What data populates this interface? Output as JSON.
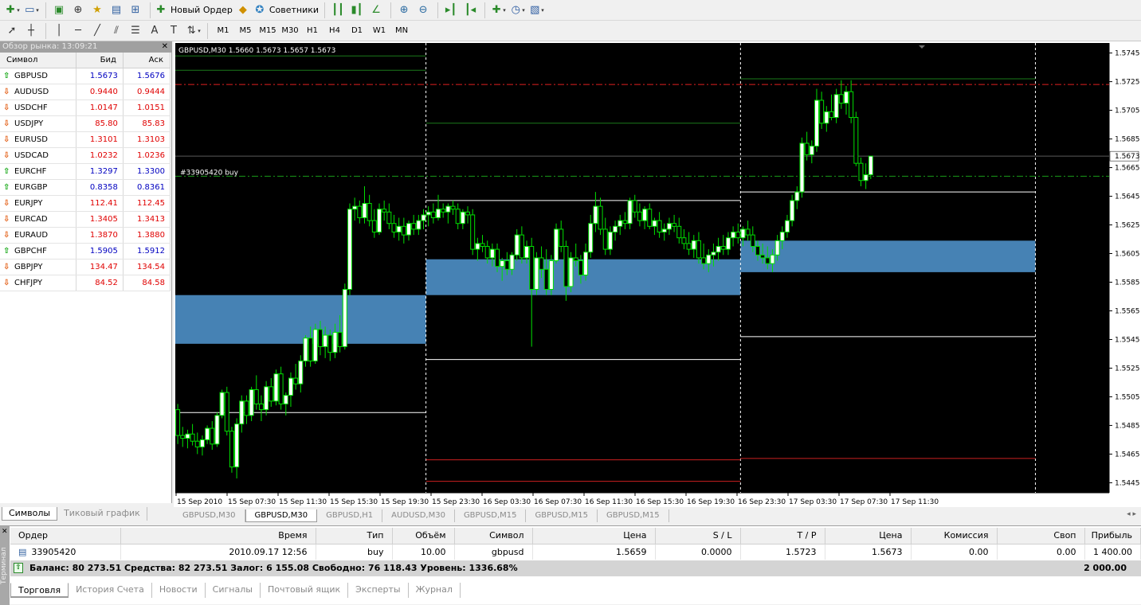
{
  "toolbar": {
    "new_order": "Новый Ордер",
    "advisors": "Советники",
    "timeframes": [
      "M1",
      "M5",
      "M15",
      "M30",
      "H1",
      "H4",
      "D1",
      "W1",
      "MN"
    ]
  },
  "market_watch": {
    "title": "Обзор рынка: 13:09:21",
    "columns": [
      "Символ",
      "Бид",
      "Аск"
    ],
    "rows": [
      {
        "symbol": "GBPUSD",
        "bid": "1.5673",
        "ask": "1.5676",
        "dir": "up"
      },
      {
        "symbol": "AUDUSD",
        "bid": "0.9440",
        "ask": "0.9444",
        "dir": "down"
      },
      {
        "symbol": "USDCHF",
        "bid": "1.0147",
        "ask": "1.0151",
        "dir": "down"
      },
      {
        "symbol": "USDJPY",
        "bid": "85.80",
        "ask": "85.83",
        "dir": "down"
      },
      {
        "symbol": "EURUSD",
        "bid": "1.3101",
        "ask": "1.3103",
        "dir": "down"
      },
      {
        "symbol": "USDCAD",
        "bid": "1.0232",
        "ask": "1.0236",
        "dir": "down"
      },
      {
        "symbol": "EURCHF",
        "bid": "1.3297",
        "ask": "1.3300",
        "dir": "up"
      },
      {
        "symbol": "EURGBP",
        "bid": "0.8358",
        "ask": "0.8361",
        "dir": "up"
      },
      {
        "symbol": "EURJPY",
        "bid": "112.41",
        "ask": "112.45",
        "dir": "down"
      },
      {
        "symbol": "EURCAD",
        "bid": "1.3405",
        "ask": "1.3413",
        "dir": "down"
      },
      {
        "symbol": "EURAUD",
        "bid": "1.3870",
        "ask": "1.3880",
        "dir": "down"
      },
      {
        "symbol": "GBPCHF",
        "bid": "1.5905",
        "ask": "1.5912",
        "dir": "up"
      },
      {
        "symbol": "GBPJPY",
        "bid": "134.47",
        "ask": "134.54",
        "dir": "down"
      },
      {
        "symbol": "CHFJPY",
        "bid": "84.52",
        "ask": "84.58",
        "dir": "down"
      }
    ],
    "tabs": [
      "Символы",
      "Тиковый график"
    ]
  },
  "chart": {
    "header": "GBPUSD,M30  1.5660 1.5673 1.5657 1.5673",
    "order_label": "#33905420 buy",
    "current_price": "1.5673",
    "price_ticks": [
      "1.5745",
      "1.5725",
      "1.5705",
      "1.5685",
      "1.5665",
      "1.5645",
      "1.5625",
      "1.5605",
      "1.5585",
      "1.5565",
      "1.5545",
      "1.5525",
      "1.5505",
      "1.5485",
      "1.5465",
      "1.5445"
    ],
    "time_ticks": [
      "15 Sep 2010",
      "15 Sep 07:30",
      "15 Sep 11:30",
      "15 Sep 15:30",
      "15 Sep 19:30",
      "15 Sep 23:30",
      "16 Sep 03:30",
      "16 Sep 07:30",
      "16 Sep 11:30",
      "16 Sep 15:30",
      "16 Sep 19:30",
      "16 Sep 23:30",
      "17 Sep 03:30",
      "17 Sep 07:30",
      "17 Sep 11:30"
    ],
    "tabs": [
      "GBPUSD,M30",
      "GBPUSD,M30",
      "GBPUSD,H1",
      "AUDUSD,M30",
      "GBPUSD,M15",
      "GBPUSD,M15",
      "GBPUSD,M15"
    ],
    "active_tab": 1
  },
  "chart_data": {
    "type": "candlestick",
    "symbol": "GBPUSD",
    "timeframe": "M30",
    "ylim": [
      1.5438,
      1.5752
    ],
    "last_price": 1.5673,
    "order_price": 1.5659,
    "take_profit": 1.5723,
    "zones": [
      {
        "from_bar": 0,
        "to_bar": 51,
        "low": 1.5542,
        "high": 1.5576,
        "color": "#4682b4"
      },
      {
        "from_bar": 51,
        "to_bar": 115,
        "low": 1.5576,
        "high": 1.5601,
        "color": "#4682b4"
      },
      {
        "from_bar": 115,
        "to_bar": 175,
        "low": 1.5592,
        "high": 1.5614,
        "color": "#4682b4"
      }
    ],
    "hlines": [
      {
        "from_bar": 0,
        "to_bar": 51,
        "price": 1.5494,
        "color": "#ffffff"
      },
      {
        "from_bar": 51,
        "to_bar": 115,
        "price": 1.5531,
        "color": "#ffffff"
      },
      {
        "from_bar": 51,
        "to_bar": 115,
        "price": 1.5642,
        "color": "#ffffff"
      },
      {
        "from_bar": 115,
        "to_bar": 175,
        "price": 1.5547,
        "color": "#ffffff"
      },
      {
        "from_bar": 115,
        "to_bar": 175,
        "price": 1.5648,
        "color": "#ffffff"
      },
      {
        "from_bar": 0,
        "to_bar": 51,
        "price": 1.5733,
        "color": "#1a7a1a"
      },
      {
        "from_bar": 0,
        "to_bar": 51,
        "price": 1.5743,
        "color": "#1a7a1a"
      },
      {
        "from_bar": 51,
        "to_bar": 115,
        "price": 1.5696,
        "color": "#1a7a1a"
      },
      {
        "from_bar": 115,
        "to_bar": 175,
        "price": 1.5727,
        "color": "#1a7a1a"
      },
      {
        "from_bar": 51,
        "to_bar": 115,
        "price": 1.5446,
        "color": "#cc2020"
      },
      {
        "from_bar": 51,
        "to_bar": 115,
        "price": 1.5461,
        "color": "#cc2020"
      },
      {
        "from_bar": 115,
        "to_bar": 175,
        "price": 1.5462,
        "color": "#cc2020"
      }
    ],
    "vlines_bars": [
      51,
      115,
      175
    ],
    "candles": [
      [
        1.5496,
        1.55,
        1.5472,
        1.5478
      ],
      [
        1.5478,
        1.5484,
        1.547,
        1.5476
      ],
      [
        1.5476,
        1.5482,
        1.5469,
        1.5479
      ],
      [
        1.5479,
        1.5486,
        1.5471,
        1.5474
      ],
      [
        1.5474,
        1.548,
        1.5465,
        1.547
      ],
      [
        1.547,
        1.5478,
        1.5464,
        1.5475
      ],
      [
        1.5475,
        1.5485,
        1.5472,
        1.5483
      ],
      [
        1.5483,
        1.5488,
        1.5468,
        1.5472
      ],
      [
        1.5472,
        1.5494,
        1.547,
        1.5492
      ],
      [
        1.5492,
        1.551,
        1.549,
        1.5508
      ],
      [
        1.5508,
        1.5512,
        1.5478,
        1.5481
      ],
      [
        1.5481,
        1.5484,
        1.5452,
        1.5456
      ],
      [
        1.5456,
        1.549,
        1.5448,
        1.5486
      ],
      [
        1.5486,
        1.5506,
        1.548,
        1.5502
      ],
      [
        1.5502,
        1.5506,
        1.5486,
        1.5492
      ],
      [
        1.5492,
        1.5512,
        1.5488,
        1.551
      ],
      [
        1.551,
        1.552,
        1.5496,
        1.55
      ],
      [
        1.55,
        1.5506,
        1.5488,
        1.5496
      ],
      [
        1.5496,
        1.5516,
        1.5492,
        1.5512
      ],
      [
        1.5512,
        1.5518,
        1.5498,
        1.5502
      ],
      [
        1.5502,
        1.5524,
        1.5499,
        1.5521
      ],
      [
        1.5521,
        1.5526,
        1.5496,
        1.55
      ],
      [
        1.55,
        1.5508,
        1.5492,
        1.5506
      ],
      [
        1.5506,
        1.5522,
        1.5498,
        1.5518
      ],
      [
        1.5518,
        1.5528,
        1.551,
        1.5514
      ],
      [
        1.5514,
        1.5534,
        1.5508,
        1.553
      ],
      [
        1.553,
        1.5548,
        1.5526,
        1.5546
      ],
      [
        1.5546,
        1.5554,
        1.5526,
        1.553
      ],
      [
        1.553,
        1.5556,
        1.5528,
        1.5552
      ],
      [
        1.5552,
        1.5558,
        1.5534,
        1.554
      ],
      [
        1.554,
        1.5554,
        1.5532,
        1.5548
      ],
      [
        1.5548,
        1.5552,
        1.553,
        1.5536
      ],
      [
        1.5536,
        1.5556,
        1.5532,
        1.555
      ],
      [
        1.555,
        1.5562,
        1.5536,
        1.554
      ],
      [
        1.554,
        1.5584,
        1.5538,
        1.558
      ],
      [
        1.558,
        1.564,
        1.5576,
        1.5636
      ],
      [
        1.5636,
        1.5644,
        1.5628,
        1.5638
      ],
      [
        1.5638,
        1.5642,
        1.5626,
        1.563
      ],
      [
        1.563,
        1.5652,
        1.5626,
        1.564
      ],
      [
        1.564,
        1.5646,
        1.5624,
        1.5628
      ],
      [
        1.5628,
        1.5636,
        1.5616,
        1.562
      ],
      [
        1.562,
        1.564,
        1.5618,
        1.5636
      ],
      [
        1.5636,
        1.5642,
        1.5628,
        1.5634
      ],
      [
        1.5634,
        1.564,
        1.5622,
        1.5626
      ],
      [
        1.5626,
        1.5632,
        1.5616,
        1.562
      ],
      [
        1.562,
        1.563,
        1.5614,
        1.5624
      ],
      [
        1.5624,
        1.563,
        1.5612,
        1.5618
      ],
      [
        1.5618,
        1.5628,
        1.5614,
        1.5626
      ],
      [
        1.5626,
        1.5632,
        1.5618,
        1.5622
      ],
      [
        1.5622,
        1.5632,
        1.5618,
        1.5628
      ],
      [
        1.5628,
        1.5636,
        1.5622,
        1.5632
      ],
      [
        1.5632,
        1.5638,
        1.5624,
        1.5634
      ],
      [
        1.5634,
        1.564,
        1.5626,
        1.563
      ],
      [
        1.563,
        1.5646,
        1.5628,
        1.5636
      ],
      [
        1.5636,
        1.564,
        1.563,
        1.5634
      ],
      [
        1.5634,
        1.564,
        1.5626,
        1.5638
      ],
      [
        1.5638,
        1.5642,
        1.5632,
        1.5636
      ],
      [
        1.5636,
        1.564,
        1.5622,
        1.5626
      ],
      [
        1.5626,
        1.5636,
        1.5622,
        1.5634
      ],
      [
        1.5634,
        1.5638,
        1.5626,
        1.5632
      ],
      [
        1.5632,
        1.5636,
        1.5604,
        1.5608
      ],
      [
        1.5608,
        1.5616,
        1.56,
        1.5612
      ],
      [
        1.5612,
        1.5618,
        1.5606,
        1.561
      ],
      [
        1.561,
        1.5614,
        1.5598,
        1.5602
      ],
      [
        1.5602,
        1.5612,
        1.5596,
        1.5608
      ],
      [
        1.5608,
        1.5612,
        1.5592,
        1.5596
      ],
      [
        1.5596,
        1.5602,
        1.5586,
        1.56
      ],
      [
        1.56,
        1.5606,
        1.559,
        1.5594
      ],
      [
        1.5594,
        1.5606,
        1.559,
        1.5604
      ],
      [
        1.5604,
        1.5622,
        1.56,
        1.5618
      ],
      [
        1.5618,
        1.5624,
        1.5598,
        1.5602
      ],
      [
        1.5602,
        1.5614,
        1.5598,
        1.561
      ],
      [
        1.561,
        1.5616,
        1.554,
        1.558
      ],
      [
        1.558,
        1.5606,
        1.5576,
        1.5602
      ],
      [
        1.5602,
        1.561,
        1.5588,
        1.5594
      ],
      [
        1.5594,
        1.5608,
        1.5576,
        1.558
      ],
      [
        1.558,
        1.5604,
        1.5576,
        1.56
      ],
      [
        1.56,
        1.5626,
        1.5598,
        1.5622
      ],
      [
        1.5622,
        1.5628,
        1.5606,
        1.561
      ],
      [
        1.561,
        1.5614,
        1.5572,
        1.5582
      ],
      [
        1.5582,
        1.5606,
        1.5578,
        1.5602
      ],
      [
        1.5602,
        1.5612,
        1.5596,
        1.56
      ],
      [
        1.56,
        1.5604,
        1.5584,
        1.559
      ],
      [
        1.559,
        1.5612,
        1.5586,
        1.5606
      ],
      [
        1.5606,
        1.5632,
        1.5602,
        1.5626
      ],
      [
        1.5626,
        1.5648,
        1.562,
        1.5638
      ],
      [
        1.5638,
        1.5644,
        1.5618,
        1.5622
      ],
      [
        1.5622,
        1.563,
        1.5604,
        1.5608
      ],
      [
        1.5608,
        1.5624,
        1.5604,
        1.562
      ],
      [
        1.562,
        1.5628,
        1.5614,
        1.5624
      ],
      [
        1.5624,
        1.5632,
        1.5618,
        1.5628
      ],
      [
        1.5628,
        1.5634,
        1.5622,
        1.5626
      ],
      [
        1.5626,
        1.5644,
        1.5622,
        1.5642
      ],
      [
        1.5642,
        1.5646,
        1.563,
        1.5634
      ],
      [
        1.5634,
        1.564,
        1.5624,
        1.5628
      ],
      [
        1.5628,
        1.5638,
        1.5622,
        1.5636
      ],
      [
        1.5636,
        1.564,
        1.5622,
        1.5624
      ],
      [
        1.5624,
        1.563,
        1.5618,
        1.5628
      ],
      [
        1.5628,
        1.5634,
        1.5616,
        1.562
      ],
      [
        1.562,
        1.5626,
        1.5614,
        1.5622
      ],
      [
        1.5622,
        1.563,
        1.5618,
        1.5626
      ],
      [
        1.5626,
        1.5632,
        1.562,
        1.5624
      ],
      [
        1.5624,
        1.563,
        1.5612,
        1.5616
      ],
      [
        1.5616,
        1.5622,
        1.5608,
        1.5612
      ],
      [
        1.5612,
        1.562,
        1.5604,
        1.5608
      ],
      [
        1.5608,
        1.5618,
        1.5602,
        1.5614
      ],
      [
        1.5614,
        1.562,
        1.5598,
        1.5602
      ],
      [
        1.5602,
        1.5612,
        1.5594,
        1.5598
      ],
      [
        1.5598,
        1.5608,
        1.5592,
        1.5604
      ],
      [
        1.5604,
        1.5612,
        1.5596,
        1.5606
      ],
      [
        1.5606,
        1.5616,
        1.56,
        1.561
      ],
      [
        1.561,
        1.5618,
        1.5604,
        1.5608
      ],
      [
        1.5608,
        1.562,
        1.5604,
        1.5616
      ],
      [
        1.5616,
        1.5624,
        1.561,
        1.562
      ],
      [
        1.562,
        1.5626,
        1.5612,
        1.5616
      ],
      [
        1.5616,
        1.5624,
        1.561,
        1.5622
      ],
      [
        1.5622,
        1.5628,
        1.5614,
        1.5618
      ],
      [
        1.5618,
        1.5624,
        1.5606,
        1.561
      ],
      [
        1.561,
        1.5614,
        1.56,
        1.5604
      ],
      [
        1.5604,
        1.5612,
        1.5598,
        1.5602
      ],
      [
        1.5602,
        1.561,
        1.5594,
        1.5598
      ],
      [
        1.5598,
        1.5608,
        1.5592,
        1.5604
      ],
      [
        1.5604,
        1.5618,
        1.56,
        1.5614
      ],
      [
        1.5614,
        1.5624,
        1.5608,
        1.562
      ],
      [
        1.562,
        1.5632,
        1.5616,
        1.5628
      ],
      [
        1.5628,
        1.5646,
        1.5624,
        1.5642
      ],
      [
        1.5642,
        1.5652,
        1.5636,
        1.5648
      ],
      [
        1.5648,
        1.5686,
        1.5644,
        1.5682
      ],
      [
        1.5682,
        1.569,
        1.567,
        1.5674
      ],
      [
        1.5674,
        1.5684,
        1.5668,
        1.568
      ],
      [
        1.568,
        1.572,
        1.5676,
        1.5712
      ],
      [
        1.5712,
        1.5718,
        1.5692,
        1.5696
      ],
      [
        1.5696,
        1.5708,
        1.569,
        1.5704
      ],
      [
        1.5704,
        1.5716,
        1.5698,
        1.57
      ],
      [
        1.57,
        1.572,
        1.5696,
        1.5716
      ],
      [
        1.5716,
        1.5726,
        1.5706,
        1.571
      ],
      [
        1.571,
        1.5722,
        1.5702,
        1.5718
      ],
      [
        1.5718,
        1.5726,
        1.5696,
        1.57
      ],
      [
        1.57,
        1.5704,
        1.5666,
        1.5668
      ],
      [
        1.5668,
        1.5672,
        1.5652,
        1.5656
      ],
      [
        1.5656,
        1.5668,
        1.565,
        1.566
      ],
      [
        1.566,
        1.5673,
        1.5657,
        1.5673
      ]
    ]
  },
  "terminal": {
    "side_label": "Терминал",
    "columns": [
      "Ордер",
      "Время",
      "Тип",
      "Объём",
      "Символ",
      "Цена",
      "S / L",
      "T / P",
      "Цена",
      "Комиссия",
      "Своп",
      "Прибыль"
    ],
    "order": {
      "id": "33905420",
      "time": "2010.09.17 12:56",
      "type": "buy",
      "volume": "10.00",
      "symbol": "gbpusd",
      "price": "1.5659",
      "sl": "0.0000",
      "tp": "1.5723",
      "cur": "1.5673",
      "commission": "0.00",
      "swap": "0.00",
      "profit": "1 400.00"
    },
    "balance_line": "Баланс: 80 273.51  Средства: 82 273.51  Залог: 6 155.08  Свободно: 76 118.43  Уровень: 1336.68%",
    "total_profit": "2 000.00",
    "tabs": [
      "Торговля",
      "История Счета",
      "Новости",
      "Сигналы",
      "Почтовый ящик",
      "Эксперты",
      "Журнал"
    ]
  }
}
